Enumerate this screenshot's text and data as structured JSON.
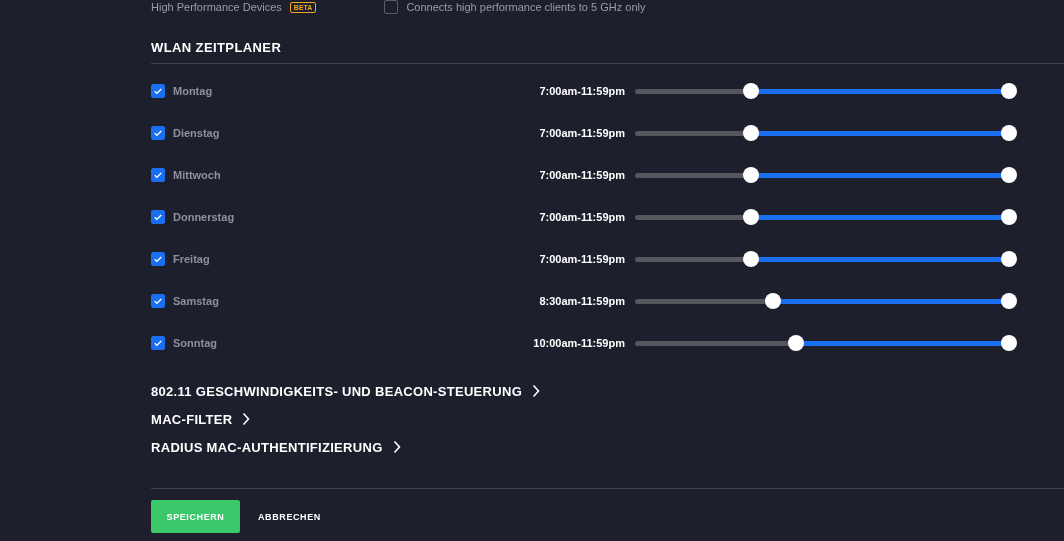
{
  "top_option": {
    "label": "High Performance Devices",
    "badge": "BETA",
    "checked": false,
    "description": "Connects high performance clients to 5 GHz only"
  },
  "schedule": {
    "title": "WLAN ZEITPLANER",
    "days": [
      {
        "name": "Montag",
        "checked": true,
        "range": "7:00am-11:59pm",
        "low": {
          "level": 0.31
        },
        "high": {
          "level": 1
        }
      },
      {
        "name": "Dienstag",
        "checked": true,
        "range": "7:00am-11:59pm",
        "low": {
          "level": 0.31
        },
        "high": {
          "level": 1
        }
      },
      {
        "name": "Mittwoch",
        "checked": true,
        "range": "7:00am-11:59pm",
        "low": {
          "level": 0.31
        },
        "high": {
          "level": 1
        }
      },
      {
        "name": "Donnerstag",
        "checked": true,
        "range": "7:00am-11:59pm",
        "low": {
          "level": 0.31
        },
        "high": {
          "level": 1
        }
      },
      {
        "name": "Freitag",
        "checked": true,
        "range": "7:00am-11:59pm",
        "low": {
          "level": 0.31
        },
        "high": {
          "level": 1
        }
      },
      {
        "name": "Samstag",
        "checked": true,
        "range": "8:30am-11:59pm",
        "low": {
          "level": 0.37
        },
        "high": {
          "level": 1
        }
      },
      {
        "name": "Sonntag",
        "checked": true,
        "range": "10:00am-11:59pm",
        "low": {
          "level": 0.43
        },
        "high": {
          "level": 1
        }
      }
    ]
  },
  "sections": [
    "802.11 GESCHWINDIGKEITS- UND BEACON-STEUERUNG",
    "MAC-FILTER",
    "RADIUS MAC-AUTHENTIFIZIERUNG"
  ],
  "buttons": {
    "save": "SPEICHERN",
    "cancel": "ABBRECHEN"
  }
}
